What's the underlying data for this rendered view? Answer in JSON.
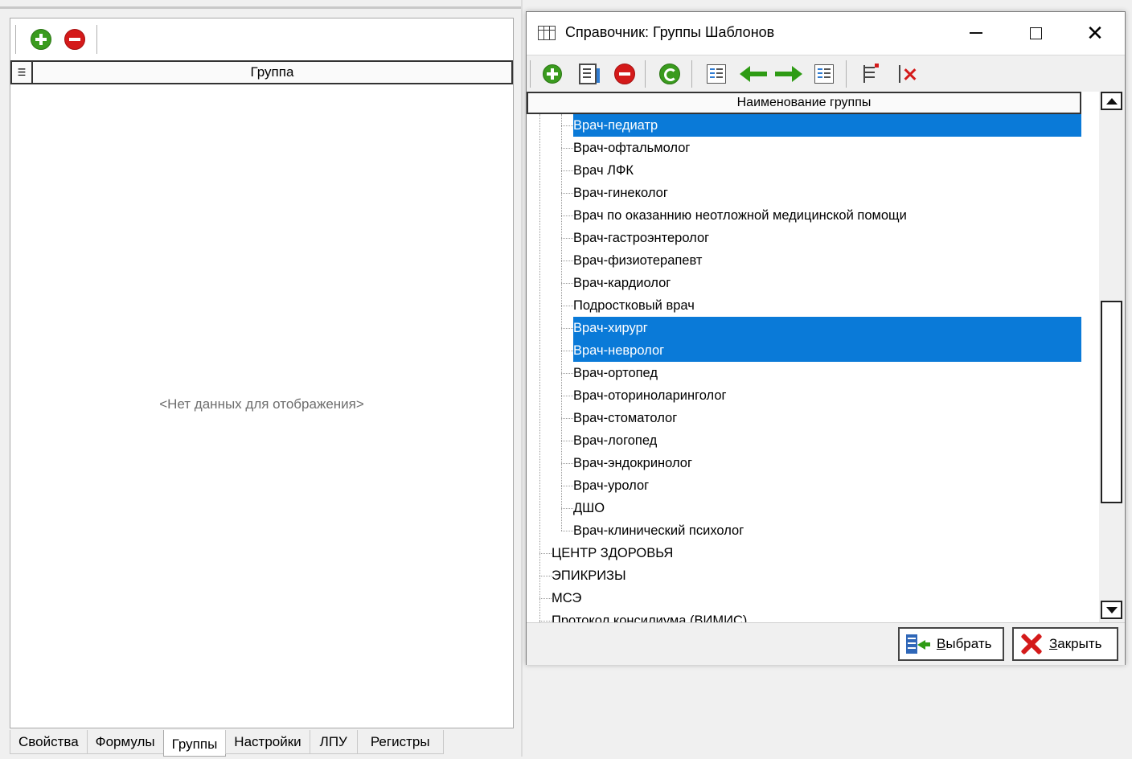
{
  "left_panel": {
    "toolbar": {
      "add_icon": "add-circle-icon",
      "remove_icon": "remove-circle-icon"
    },
    "grid_header": "Группа",
    "empty_message": "<Нет данных для отображения>",
    "tabs": [
      {
        "label": "Свойства",
        "active": false
      },
      {
        "label": "Формулы",
        "active": false
      },
      {
        "label": "Группы",
        "active": true
      },
      {
        "label": "Настройки",
        "active": false
      },
      {
        "label": "ЛПУ",
        "active": false
      },
      {
        "label": "Регистры",
        "active": false
      }
    ]
  },
  "dialog": {
    "title": "Справочник: Группы Шаблонов",
    "column_header": "Наименование группы",
    "tree_rows": [
      {
        "label": "Врач-педиатр",
        "level": 2,
        "selected": true
      },
      {
        "label": "Врач-офтальмолог",
        "level": 2,
        "selected": false
      },
      {
        "label": "Врач ЛФК",
        "level": 2,
        "selected": false
      },
      {
        "label": "Врач-гинеколог",
        "level": 2,
        "selected": false
      },
      {
        "label": "Врач по оказаннию неотложной медицинской помощи",
        "level": 2,
        "selected": false
      },
      {
        "label": "Врач-гастроэнтеролог",
        "level": 2,
        "selected": false
      },
      {
        "label": "Врач-физиотерапевт",
        "level": 2,
        "selected": false
      },
      {
        "label": "Врач-кардиолог",
        "level": 2,
        "selected": false
      },
      {
        "label": "Подростковый врач",
        "level": 2,
        "selected": false
      },
      {
        "label": "Врач-хирург",
        "level": 2,
        "selected": true
      },
      {
        "label": "Врач-невролог",
        "level": 2,
        "selected": true
      },
      {
        "label": "Врач-ортопед",
        "level": 2,
        "selected": false
      },
      {
        "label": "Врач-оториноларинголог",
        "level": 2,
        "selected": false
      },
      {
        "label": "Врач-стоматолог",
        "level": 2,
        "selected": false
      },
      {
        "label": "Врач-логопед",
        "level": 2,
        "selected": false
      },
      {
        "label": "Врач-эндокринолог",
        "level": 2,
        "selected": false
      },
      {
        "label": "Врач-уролог",
        "level": 2,
        "selected": false
      },
      {
        "label": "ДШО",
        "level": 2,
        "selected": false
      },
      {
        "label": "Врач-клинический психолог",
        "level": 2,
        "selected": false
      },
      {
        "label": "ЦЕНТР ЗДОРОВЬЯ",
        "level": 1,
        "selected": false
      },
      {
        "label": "ЭПИКРИЗЫ",
        "level": 1,
        "selected": false
      },
      {
        "label": "МСЭ",
        "level": 1,
        "selected": false
      },
      {
        "label": "Протокол консилиума (ВИМИС)",
        "level": 1,
        "selected": false
      }
    ],
    "footer": {
      "select_label": "Выбрать",
      "close_label": "Закрыть"
    },
    "colors": {
      "selection": "#0a7ad8",
      "add_green": "#3a9b1e",
      "remove_red": "#d41a1a"
    }
  }
}
